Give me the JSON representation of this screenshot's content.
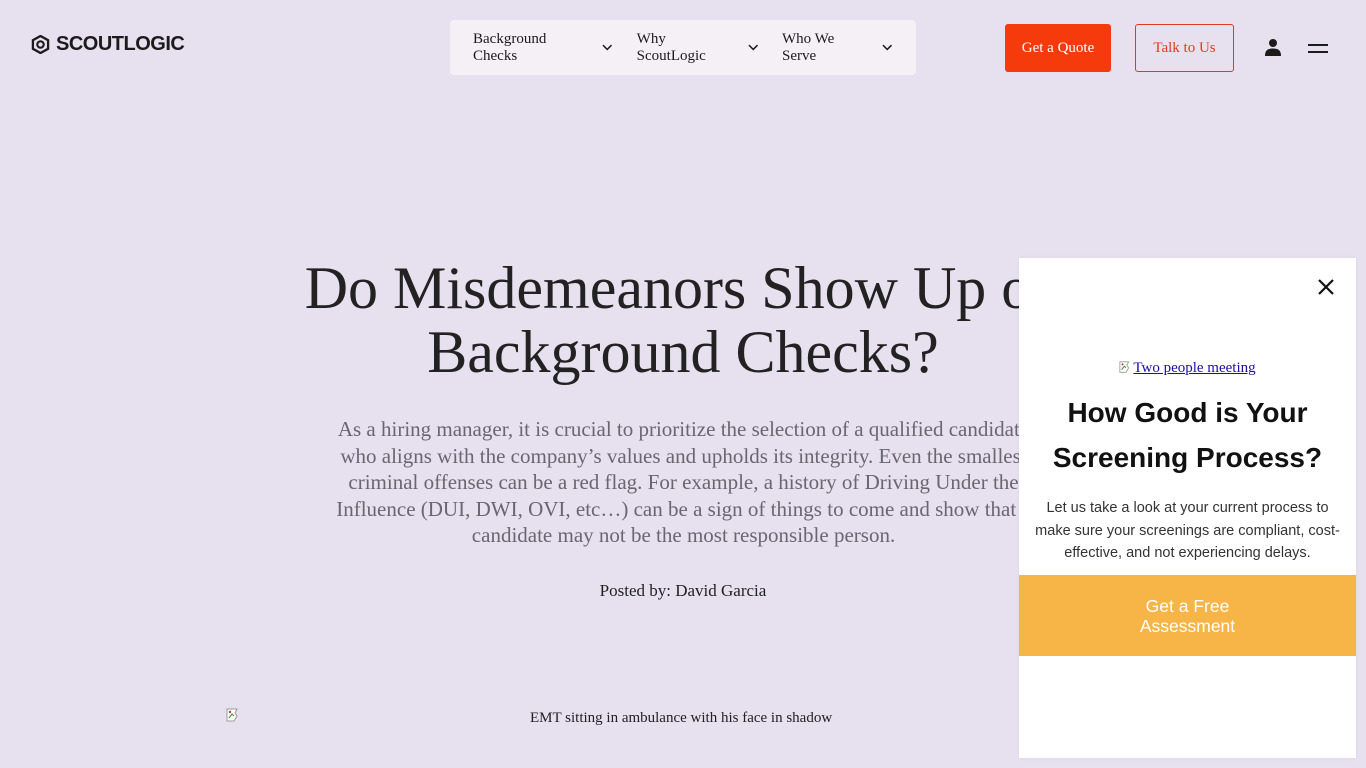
{
  "header": {
    "logo_text": "SCOUTLOGIC",
    "nav": [
      {
        "label": "Background Checks"
      },
      {
        "label": "Why ScoutLogic"
      },
      {
        "label": "Who We Serve"
      }
    ],
    "quote_label": "Get a Quote",
    "talk_label": "Talk to Us",
    "icons": [
      "chevron-down-icon",
      "user-icon",
      "menu-icon"
    ]
  },
  "hero": {
    "title_line1": "Do Misdemeanors Show Up on",
    "title_line2": "Background Checks?",
    "lead": "As a hiring manager, it is crucial to prioritize the selection of a qualified candidate who aligns with the company’s values and upholds its integrity. Even the smallest criminal offenses can be a red flag. For example, a history of Driving Under the Influence (DUI, DWI, OVI, etc…) can be a sign of things to come and show that a candidate may not be the most responsible person.",
    "posted_by": "Posted by: David Garcia",
    "image_alt": "EMT sitting in ambulance with his face in shadow"
  },
  "popup": {
    "image_alt": "Two people meeting",
    "title_line1": "How Good is Your",
    "title_line2": "Screening Process?",
    "text": "Let us take a look at your current process to make sure your screenings are compliant, cost-effective, and not experiencing delays.",
    "cta_line1": "Get a Free",
    "cta_line2": "Assessment"
  },
  "colors": {
    "background": "#e6e0ef",
    "nav_background": "#f4f0f6",
    "quote_button": "#f53b0c",
    "talk_button_border": "#e13b1c",
    "cta_background": "#f7b547"
  }
}
